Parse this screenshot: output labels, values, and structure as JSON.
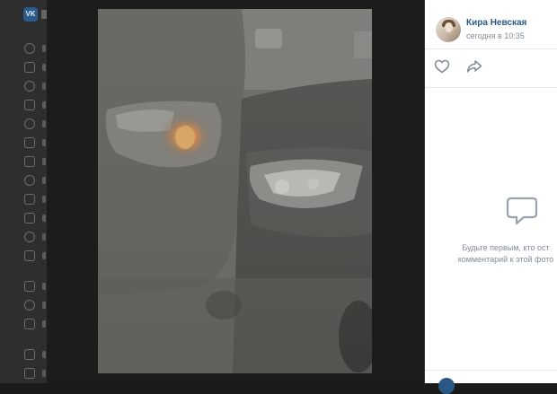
{
  "post": {
    "author": "Кира Невская",
    "date": "сегодня в 10:35"
  },
  "comments": {
    "empty_line1": "Будьте первым, кто ост",
    "empty_line2": "комментарий к этой фото"
  },
  "icons": {
    "like": "heart-icon",
    "share": "share-arrow-icon",
    "comments_empty": "comment-bubbles-icon",
    "logo": "vk-logo"
  },
  "logo_text": "VK",
  "colors": {
    "link": "#2a5885",
    "meta": "#818c99",
    "panel_bg": "#ffffff",
    "overlay": "#1c1c1c"
  }
}
